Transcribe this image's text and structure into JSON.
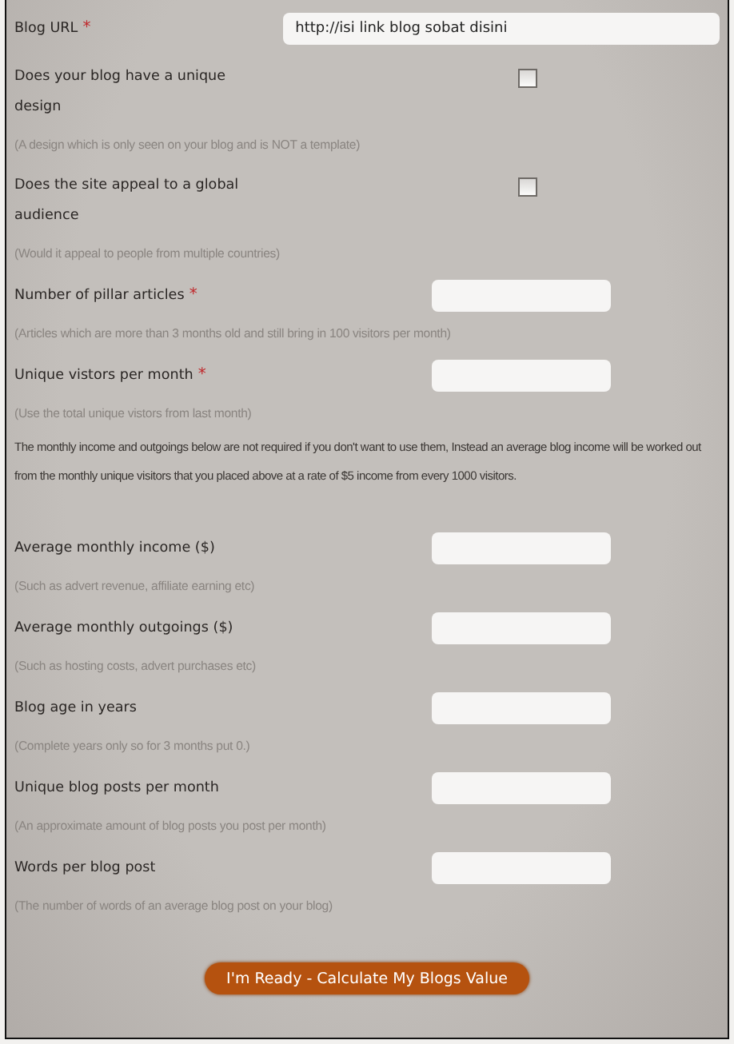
{
  "form": {
    "items": [
      {
        "kind": "wide_text",
        "label": "Blog URL",
        "required_mark": "*",
        "value": "http://isi link blog sobat disini"
      },
      {
        "kind": "checkbox",
        "label": "Does your blog have a unique design",
        "checked": false,
        "hint": "(A design which is only seen on your blog and is NOT a template)"
      },
      {
        "kind": "checkbox",
        "label": "Does the site appeal to a global audience",
        "checked": false,
        "hint": "(Would it appeal to people from multiple countries)"
      },
      {
        "kind": "text",
        "label": "Number of pillar articles",
        "required_mark": "*",
        "hint": "(Articles which are more than 3 months old and still bring in 100 visitors per month)"
      },
      {
        "kind": "text",
        "label": "Unique vistors per month",
        "required_mark": "*",
        "hint": "(Use the total unique vistors from last month)"
      },
      {
        "kind": "note",
        "text": "The monthly income and outgoings below are not required if you don't want to use them, Instead an average blog income will be worked out from the monthly unique visitors that you placed above at a rate of $5 income from every 1000 visitors."
      },
      {
        "kind": "text",
        "label": "Average monthly income ($)",
        "hint": "(Such as advert revenue, affiliate earning etc)"
      },
      {
        "kind": "text",
        "label": "Average monthly outgoings ($)",
        "hint": "(Such as hosting costs, advert purchases etc)"
      },
      {
        "kind": "text",
        "label": "Blog age in years",
        "hint": "(Complete years only so for 3 months put 0.)"
      },
      {
        "kind": "text",
        "label": "Unique blog posts per month",
        "hint": "(An approximate amount of blog posts you post per month)"
      },
      {
        "kind": "text",
        "label": "Words per blog post",
        "hint": "(The number of words of an average blog post on your blog)"
      }
    ],
    "submit_button": "I'm Ready - Calculate My Blogs Value"
  }
}
